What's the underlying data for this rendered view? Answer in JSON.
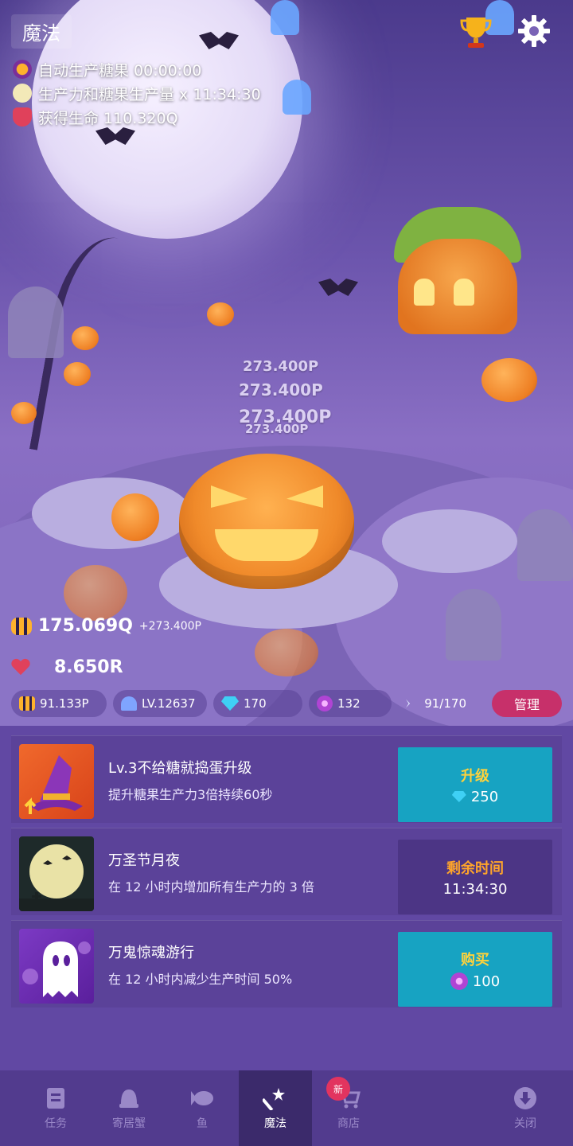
{
  "header": {
    "title": "魔法"
  },
  "buffs": [
    {
      "label": "自动生产糖果 00:00:00",
      "icon": "candy-bomb-icon"
    },
    {
      "label": "生产力和糖果生产量 x 11:34:30",
      "icon": "moon-icon"
    },
    {
      "label": "获得生命 110.320Q",
      "icon": "heart-icon"
    }
  ],
  "scene": {
    "floating_income": [
      "273.400P",
      "273.400P",
      "273.400P",
      "273.400P"
    ]
  },
  "stats": {
    "candy_total": "175.069Q",
    "candy_increment": "+273.400P",
    "life_total": "8.650R"
  },
  "resources": [
    {
      "icon": "candy-icon",
      "value": "91.133P"
    },
    {
      "icon": "crab-icon",
      "value": "LV.12637"
    },
    {
      "icon": "diamond-icon",
      "value": "170"
    },
    {
      "icon": "orb-icon",
      "value": "132"
    },
    {
      "icon": "fish-icon",
      "value": "91/170"
    }
  ],
  "manage_label": "管理",
  "cards": [
    {
      "title": "Lv.3不给糖就捣蛋升级",
      "desc": "提升糖果生产力3倍持续60秒",
      "button_label": "升级",
      "button_value": "250",
      "currency": "diamond"
    },
    {
      "title": "万圣节月夜",
      "desc": "在 12 小时内增加所有生产力的 3 倍",
      "button_label": "剩余时间",
      "button_value": "11:34:30",
      "currency": "none"
    },
    {
      "title": "万鬼惊魂游行",
      "desc": "在 12 小时内减少生产时间 50%",
      "button_label": "购买",
      "button_value": "100",
      "currency": "orb"
    }
  ],
  "nav": {
    "items": [
      {
        "label": "任务",
        "icon": "quest-icon"
      },
      {
        "label": "寄居蟹",
        "icon": "hermit-crab-icon"
      },
      {
        "label": "鱼",
        "icon": "fish-icon"
      },
      {
        "label": "魔法",
        "icon": "magic-wand-icon"
      },
      {
        "label": "商店",
        "icon": "cart-icon"
      },
      {
        "label": "关闭",
        "icon": "close-down-icon"
      }
    ],
    "new_badge": "新"
  },
  "colors": {
    "panel": "#6148a3",
    "card": "#5b4299",
    "teal_button": "#17a3c2",
    "gold_text": "#ffd23b",
    "manage_button": "#c7306a"
  }
}
